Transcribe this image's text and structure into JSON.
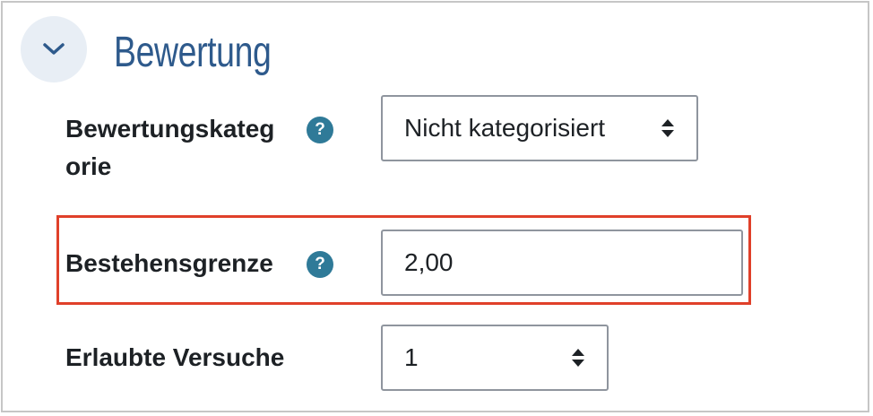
{
  "section": {
    "title": "Bewertung",
    "collapse_icon": "chevron-down-icon"
  },
  "fields": {
    "grade_category": {
      "label_line1": "Bewertungskateg",
      "label_line2": "orie",
      "help_icon_text": "?",
      "value": "Nicht kategorisiert"
    },
    "pass_grade": {
      "label": "Bestehensgrenze",
      "help_icon_text": "?",
      "value": "2,00"
    },
    "attempts": {
      "label": "Erlaubte Versuche",
      "value": "1"
    }
  },
  "colors": {
    "title": "#2e5a8c",
    "help_icon": "#2f7a98",
    "highlight": "#e0402a",
    "collapse_bg": "#e8eef5"
  }
}
